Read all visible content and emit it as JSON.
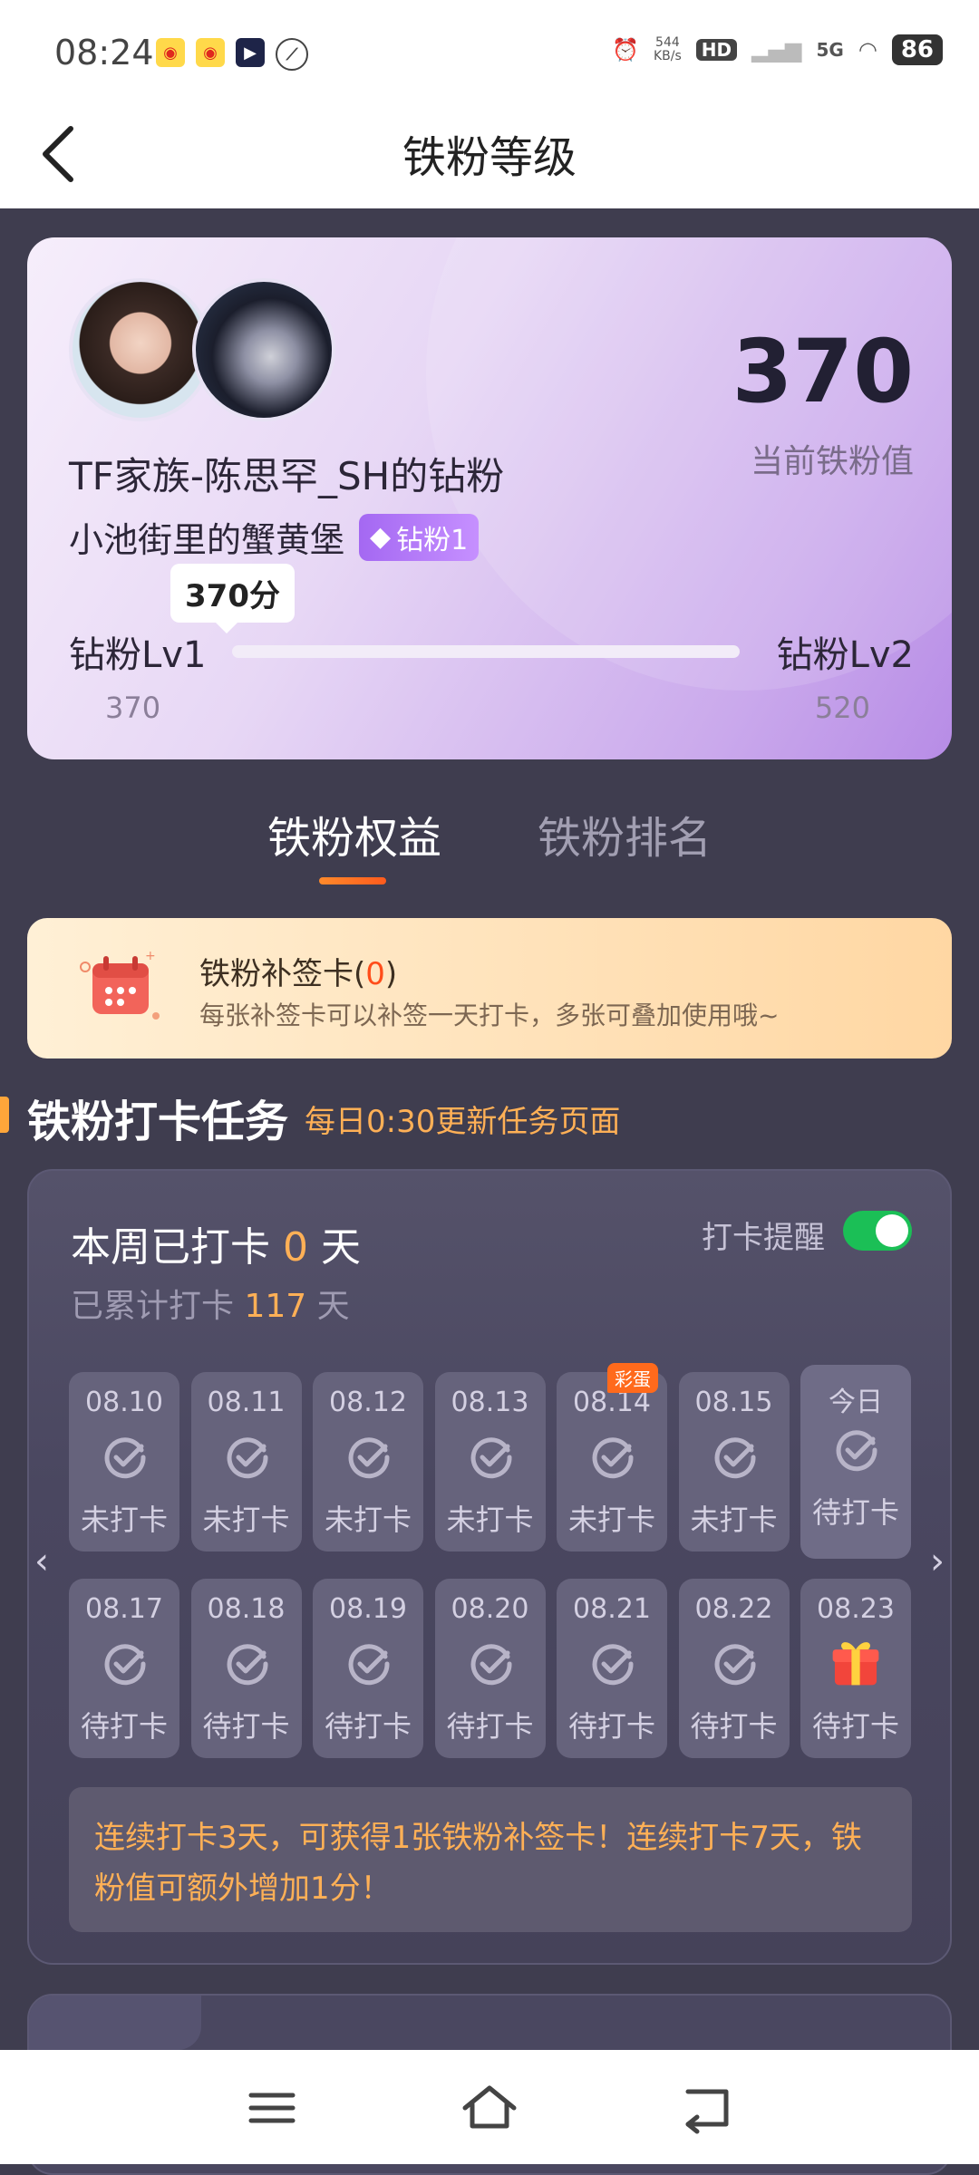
{
  "status_bar": {
    "time": "08:24",
    "net_speed_value": "544",
    "net_speed_unit": "KB/s",
    "hd": "HD",
    "signal": "5G",
    "battery": "86"
  },
  "header": {
    "title": "铁粉等级"
  },
  "level_card": {
    "score": "370",
    "score_label": "当前铁粉值",
    "group_name": "TF家族-陈思罕_SH的钻粉",
    "nickname": "小池街里的蟹黄堡",
    "badge": "钻粉1",
    "tooltip": "370分",
    "level_current": "钻粉Lv1",
    "level_next": "钻粉Lv2",
    "value_current": "370",
    "value_next": "520",
    "progress": 0.0
  },
  "tabs": [
    {
      "label": "铁粉权益",
      "active": true
    },
    {
      "label": "铁粉排名",
      "active": false
    }
  ],
  "makeup_card": {
    "title": "铁粉补签卡(",
    "count": "0",
    "title_end": ")",
    "desc": "每张补签卡可以补签一天打卡，多张可叠加使用哦~"
  },
  "task_section": {
    "title": "铁粉打卡任务",
    "subtitle": "每日0:30更新任务页面"
  },
  "checkin": {
    "week_prefix": "本周已打卡",
    "week_days": "0",
    "week_suffix": "天",
    "total_prefix": "已累计打卡",
    "total_days": "117",
    "total_suffix": "天",
    "reminder_label": "打卡提醒",
    "reminder_on": true,
    "egg_label": "彩蛋",
    "row1": [
      {
        "date": "08.10",
        "status": "未打卡"
      },
      {
        "date": "08.11",
        "status": "未打卡"
      },
      {
        "date": "08.12",
        "status": "未打卡"
      },
      {
        "date": "08.13",
        "status": "未打卡"
      },
      {
        "date": "08.14",
        "status": "未打卡"
      },
      {
        "date": "08.15",
        "status": "未打卡"
      },
      {
        "date": "今日",
        "status": "待打卡"
      }
    ],
    "row2": [
      {
        "date": "08.17",
        "status": "待打卡"
      },
      {
        "date": "08.18",
        "status": "待打卡"
      },
      {
        "date": "08.19",
        "status": "待打卡"
      },
      {
        "date": "08.20",
        "status": "待打卡"
      },
      {
        "date": "08.21",
        "status": "待打卡"
      },
      {
        "date": "08.22",
        "status": "待打卡"
      },
      {
        "date": "08.23",
        "status": "待打卡"
      }
    ],
    "note": "连续打卡3天，可获得1张铁粉补签卡！连续打卡7天，铁粉值可额外增加1分！"
  },
  "colors": {
    "accent_orange": "#ffb056",
    "toggle_green": "#1bbf56",
    "background": "#3f3d4f"
  }
}
